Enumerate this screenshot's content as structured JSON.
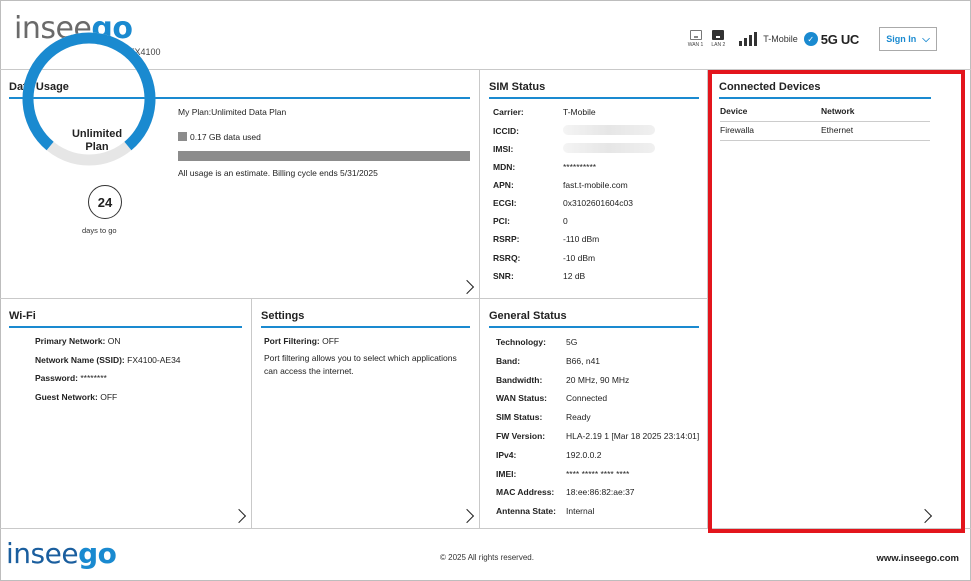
{
  "header": {
    "logo_part1": "insee",
    "logo_part2": "go",
    "model": "FX4100",
    "wan_label": "WAN 1",
    "lan_label": "LAN 2",
    "carrier": "T-Mobile",
    "network_badge": "5G UC",
    "sign_in_label": "Sign In"
  },
  "data_usage": {
    "title": "Data Usage",
    "plan_center_line1": "Unlimited",
    "plan_center_line2": "Plan",
    "days": "24",
    "days_label": "days to go",
    "my_plan": "My Plan:Unlimited Data Plan",
    "used": "0.17 GB data used",
    "note": "All usage is an estimate. Billing cycle ends 5/31/2025"
  },
  "sim_status": {
    "title": "SIM Status",
    "rows": [
      {
        "k": "Carrier:",
        "v": "T-Mobile"
      },
      {
        "k": "ICCID:",
        "v": ""
      },
      {
        "k": "IMSI:",
        "v": ""
      },
      {
        "k": "MDN:",
        "v": "**********"
      },
      {
        "k": "APN:",
        "v": "fast.t-mobile.com"
      },
      {
        "k": "ECGI:",
        "v": "0x3102601604c03"
      },
      {
        "k": "PCI:",
        "v": "0"
      },
      {
        "k": "RSRP:",
        "v": "-110 dBm"
      },
      {
        "k": "RSRQ:",
        "v": "-10 dBm"
      },
      {
        "k": "SNR:",
        "v": "12 dB"
      }
    ]
  },
  "connected_devices": {
    "title": "Connected Devices",
    "col_device": "Device",
    "col_network": "Network",
    "rows": [
      {
        "device": "Firewalla",
        "network": "Ethernet"
      }
    ]
  },
  "wifi": {
    "title": "Wi-Fi",
    "rows": [
      {
        "k": "Primary Network:",
        "v": "ON"
      },
      {
        "k": "Network Name (SSID):",
        "v": "FX4100-AE34"
      },
      {
        "k": "Password:",
        "v": "********"
      },
      {
        "k": "Guest Network:",
        "v": "OFF"
      }
    ]
  },
  "settings": {
    "title": "Settings",
    "port_filtering_k": "Port Filtering:",
    "port_filtering_v": "OFF",
    "desc_line1": "Port filtering allows you to select which applications",
    "desc_line2": "can access the internet."
  },
  "general_status": {
    "title": "General Status",
    "rows": [
      {
        "k": "Technology:",
        "v": "5G"
      },
      {
        "k": "Band:",
        "v": "B66, n41"
      },
      {
        "k": "Bandwidth:",
        "v": "20 MHz, 90 MHz"
      },
      {
        "k": "WAN Status:",
        "v": "Connected"
      },
      {
        "k": "SIM Status:",
        "v": "Ready"
      },
      {
        "k": "FW Version:",
        "v": "HLA-2.19 1 [Mar 18 2025 23:14:01]"
      },
      {
        "k": "IPv4:",
        "v": "192.0.0.2"
      },
      {
        "k": "IMEI:",
        "v": "**** ***** **** ****"
      },
      {
        "k": "MAC Address:",
        "v": "18:ee:86:82:ae:37"
      },
      {
        "k": "Antenna State:",
        "v": "Internal"
      }
    ]
  },
  "footer": {
    "logo_part1": "insee",
    "logo_part2": "go",
    "copyright": "© 2025 All rights reserved.",
    "website": "www.inseego.com"
  },
  "colors": {
    "accent": "#1a8ad0",
    "highlight": "#e3151c"
  },
  "data_usage_gauge_fraction": 0.78
}
